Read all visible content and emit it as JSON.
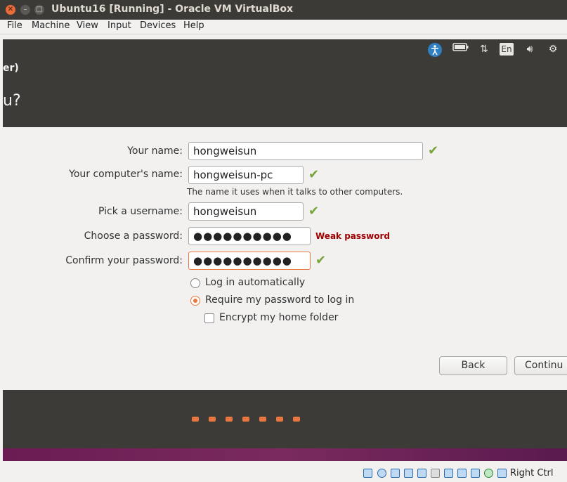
{
  "window": {
    "title": "Ubuntu16 [Running] - Oracle VM VirtualBox"
  },
  "menu": [
    "File",
    "Machine",
    "View",
    "Input",
    "Devices",
    "Help"
  ],
  "tray": {
    "language": "En"
  },
  "header": {
    "subtitle_fragment": "er)",
    "title_fragment": "u?"
  },
  "form": {
    "name_label": "Your name:",
    "name_value": "hongweisun",
    "computer_label": "Your computer's name:",
    "computer_value": "hongweisun-pc",
    "computer_hint": "The name it uses when it talks to other computers.",
    "username_label": "Pick a username:",
    "username_value": "hongweisun",
    "password_label": "Choose a password:",
    "password_value": "●●●●●●●●●●",
    "password_strength": "Weak password",
    "confirm_label": "Confirm your password:",
    "confirm_value": "●●●●●●●●●●",
    "login_auto": "Log in automatically",
    "login_require": "Require my password to log in",
    "encrypt_home": "Encrypt my home folder"
  },
  "buttons": {
    "back": "Back",
    "continue": "Continu"
  },
  "statusbar": {
    "host_key": "Right Ctrl"
  },
  "colors": {
    "accent": "#e8783f",
    "check": "#77a53a",
    "dark": "#3c3b37"
  }
}
